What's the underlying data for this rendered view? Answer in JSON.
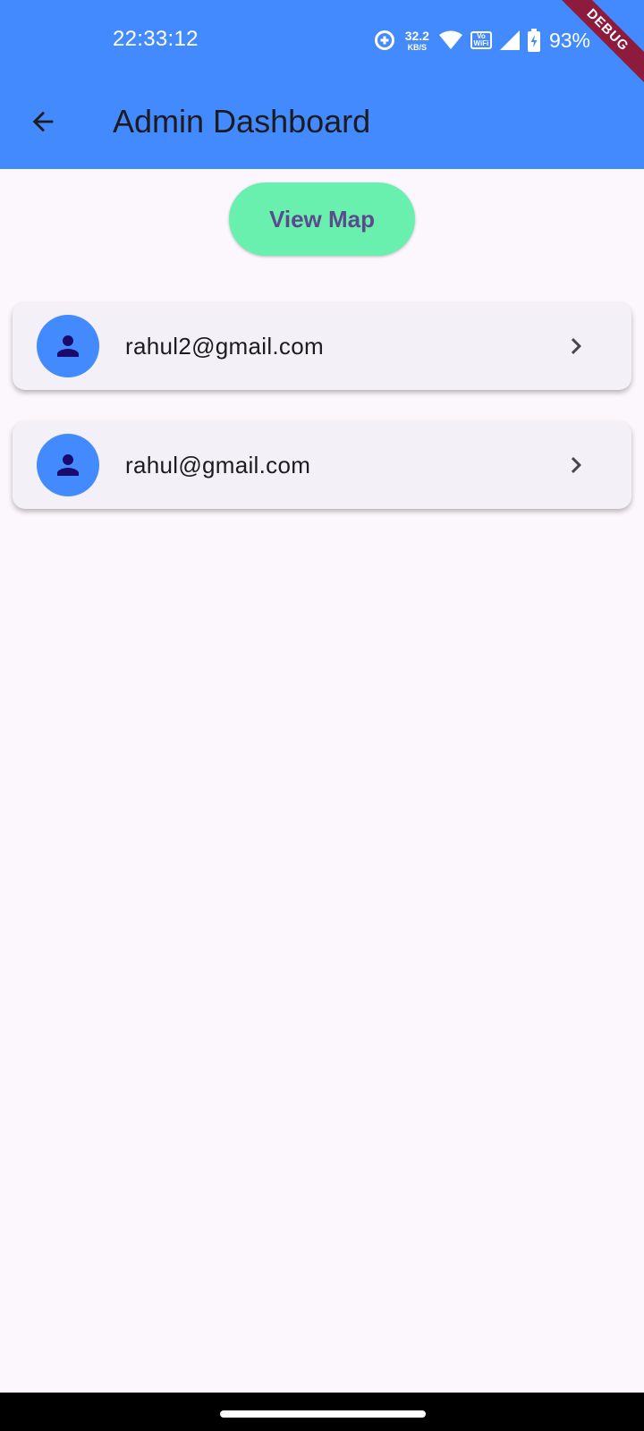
{
  "status_bar": {
    "time": "22:33:12",
    "net_speed_value": "32.2",
    "net_speed_unit": "KB/S",
    "vowifi_top": "Vo",
    "vowifi_bottom": "WiFi",
    "battery_percent": "93%",
    "icons": [
      "data-saver-icon",
      "wifi-icon",
      "vowifi-icon",
      "cell-signal-icon",
      "battery-charging-icon"
    ]
  },
  "debug_banner": "DEBUG",
  "app_bar": {
    "title": "Admin Dashboard",
    "back_icon": "arrow-back-icon",
    "color": "#448aff"
  },
  "actions": {
    "view_map_label": "View Map",
    "view_map_color": "#69f0ae"
  },
  "users": [
    {
      "email": "rahul2@gmail.com",
      "avatar_icon": "person-icon",
      "trailing_icon": "chevron-right-icon"
    },
    {
      "email": "rahul@gmail.com",
      "avatar_icon": "person-icon",
      "trailing_icon": "chevron-right-icon"
    }
  ]
}
